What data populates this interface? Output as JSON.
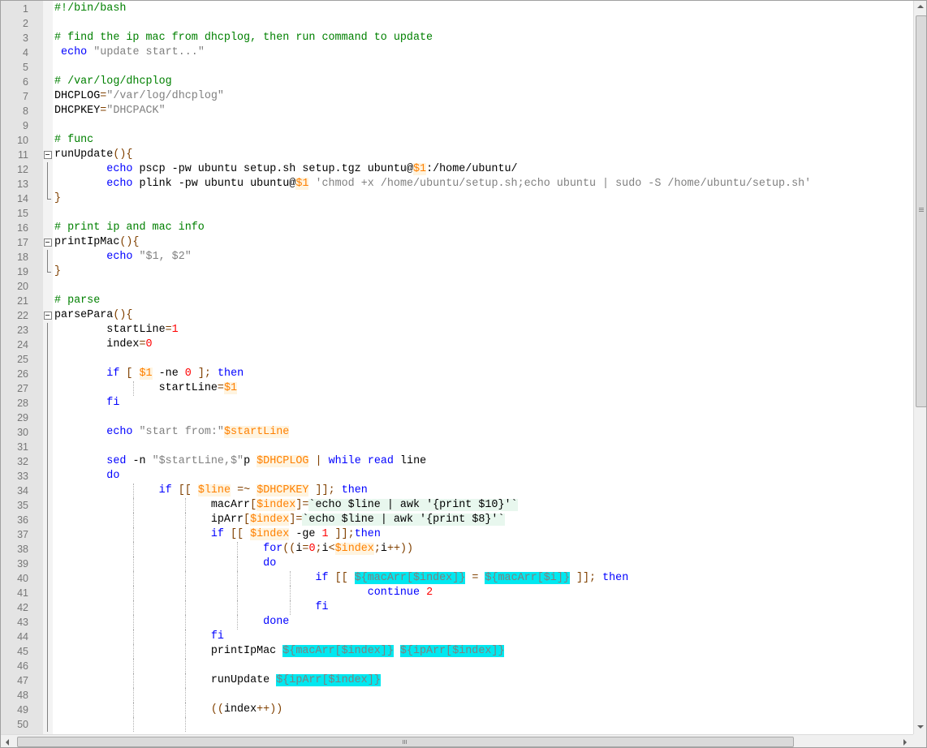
{
  "editor": {
    "language": "bash",
    "line_count_visible": 50
  },
  "colors": {
    "comment": "#008000",
    "keyword": "#0000ff",
    "string": "#808080",
    "number": "#ff0000",
    "variable": "#ff8000",
    "operator": "#804000",
    "expansion_highlight": "#00e8f0",
    "backtick_highlight": "#e8f7ee"
  },
  "lines": [
    {
      "n": "1",
      "guides": [],
      "fold": null,
      "tokens": [
        {
          "t": "c",
          "v": "#!/bin/bash"
        }
      ]
    },
    {
      "n": "2",
      "guides": [],
      "fold": null,
      "tokens": []
    },
    {
      "n": "3",
      "guides": [],
      "fold": null,
      "tokens": [
        {
          "t": "c",
          "v": "# find the ip mac from dhcplog, then run command to update"
        }
      ]
    },
    {
      "n": "4",
      "guides": [],
      "fold": null,
      "tokens": [
        {
          "t": "p",
          "v": " "
        },
        {
          "t": "k",
          "v": "echo"
        },
        {
          "t": "p",
          "v": " "
        },
        {
          "t": "s",
          "v": "\"update start...\""
        }
      ]
    },
    {
      "n": "5",
      "guides": [],
      "fold": null,
      "tokens": []
    },
    {
      "n": "6",
      "guides": [],
      "fold": null,
      "tokens": [
        {
          "t": "c",
          "v": "# /var/log/dhcplog"
        }
      ]
    },
    {
      "n": "7",
      "guides": [],
      "fold": null,
      "tokens": [
        {
          "t": "p",
          "v": "DHCPLOG"
        },
        {
          "t": "o",
          "v": "="
        },
        {
          "t": "s",
          "v": "\"/var/log/dhcplog\""
        }
      ]
    },
    {
      "n": "8",
      "guides": [],
      "fold": null,
      "tokens": [
        {
          "t": "p",
          "v": "DHCPKEY"
        },
        {
          "t": "o",
          "v": "="
        },
        {
          "t": "s",
          "v": "\"DHCPACK\""
        }
      ]
    },
    {
      "n": "9",
      "guides": [],
      "fold": null,
      "tokens": []
    },
    {
      "n": "10",
      "guides": [],
      "fold": null,
      "tokens": [
        {
          "t": "c",
          "v": "# func"
        }
      ]
    },
    {
      "n": "11",
      "guides": [],
      "fold": "box",
      "tokens": [
        {
          "t": "p",
          "v": "runUpdate"
        },
        {
          "t": "o",
          "v": "(){"
        }
      ]
    },
    {
      "n": "12",
      "guides": [],
      "fold": "vl",
      "tokens": [
        {
          "t": "p",
          "v": "        "
        },
        {
          "t": "k",
          "v": "echo"
        },
        {
          "t": "p",
          "v": " pscp -pw ubuntu setup.sh setup.tgz ubuntu@"
        },
        {
          "t": "v",
          "v": "$1"
        },
        {
          "t": "p",
          "v": ":/home/ubuntu/"
        }
      ]
    },
    {
      "n": "13",
      "guides": [],
      "fold": "vl",
      "tokens": [
        {
          "t": "p",
          "v": "        "
        },
        {
          "t": "k",
          "v": "echo"
        },
        {
          "t": "p",
          "v": " plink -pw ubuntu ubuntu@"
        },
        {
          "t": "v",
          "v": "$1"
        },
        {
          "t": "p",
          "v": " "
        },
        {
          "t": "s",
          "v": "'chmod +x /home/ubuntu/setup.sh;echo ubuntu | sudo -S /home/ubuntu/setup.sh'"
        }
      ]
    },
    {
      "n": "14",
      "guides": [],
      "fold": "end",
      "tokens": [
        {
          "t": "o",
          "v": "}"
        }
      ]
    },
    {
      "n": "15",
      "guides": [],
      "fold": null,
      "tokens": []
    },
    {
      "n": "16",
      "guides": [],
      "fold": null,
      "tokens": [
        {
          "t": "c",
          "v": "# print ip and mac info"
        }
      ]
    },
    {
      "n": "17",
      "guides": [],
      "fold": "box",
      "tokens": [
        {
          "t": "p",
          "v": "printIpMac"
        },
        {
          "t": "o",
          "v": "(){"
        }
      ]
    },
    {
      "n": "18",
      "guides": [],
      "fold": "vl",
      "tokens": [
        {
          "t": "p",
          "v": "        "
        },
        {
          "t": "k",
          "v": "echo"
        },
        {
          "t": "p",
          "v": " "
        },
        {
          "t": "s",
          "v": "\"$1, $2\""
        }
      ]
    },
    {
      "n": "19",
      "guides": [],
      "fold": "end",
      "tokens": [
        {
          "t": "o",
          "v": "}"
        }
      ]
    },
    {
      "n": "20",
      "guides": [],
      "fold": null,
      "tokens": []
    },
    {
      "n": "21",
      "guides": [],
      "fold": null,
      "tokens": [
        {
          "t": "c",
          "v": "# parse"
        }
      ]
    },
    {
      "n": "22",
      "guides": [],
      "fold": "box",
      "tokens": [
        {
          "t": "p",
          "v": "parsePara"
        },
        {
          "t": "o",
          "v": "(){"
        }
      ]
    },
    {
      "n": "23",
      "guides": [],
      "fold": "vl",
      "tokens": [
        {
          "t": "p",
          "v": "        startLine"
        },
        {
          "t": "o",
          "v": "="
        },
        {
          "t": "n",
          "v": "1"
        }
      ]
    },
    {
      "n": "24",
      "guides": [],
      "fold": "vl",
      "tokens": [
        {
          "t": "p",
          "v": "        index"
        },
        {
          "t": "o",
          "v": "="
        },
        {
          "t": "n",
          "v": "0"
        }
      ]
    },
    {
      "n": "25",
      "guides": [],
      "fold": "vl",
      "tokens": []
    },
    {
      "n": "26",
      "guides": [],
      "fold": "vl",
      "tokens": [
        {
          "t": "p",
          "v": "        "
        },
        {
          "t": "k",
          "v": "if"
        },
        {
          "t": "p",
          "v": " "
        },
        {
          "t": "o",
          "v": "["
        },
        {
          "t": "p",
          "v": " "
        },
        {
          "t": "v",
          "v": "$1"
        },
        {
          "t": "p",
          "v": " -ne "
        },
        {
          "t": "n",
          "v": "0"
        },
        {
          "t": "p",
          "v": " "
        },
        {
          "t": "o",
          "v": "];"
        },
        {
          "t": "p",
          "v": " "
        },
        {
          "t": "k",
          "v": "then"
        }
      ]
    },
    {
      "n": "27",
      "guides": [
        12
      ],
      "fold": "vl",
      "tokens": [
        {
          "t": "p",
          "v": "                startLine"
        },
        {
          "t": "o",
          "v": "="
        },
        {
          "t": "v",
          "v": "$1"
        }
      ]
    },
    {
      "n": "28",
      "guides": [],
      "fold": "vl",
      "tokens": [
        {
          "t": "p",
          "v": "        "
        },
        {
          "t": "k",
          "v": "fi"
        }
      ]
    },
    {
      "n": "29",
      "guides": [],
      "fold": "vl",
      "tokens": []
    },
    {
      "n": "30",
      "guides": [],
      "fold": "vl",
      "tokens": [
        {
          "t": "p",
          "v": "        "
        },
        {
          "t": "k",
          "v": "echo"
        },
        {
          "t": "p",
          "v": " "
        },
        {
          "t": "s",
          "v": "\"start from:\""
        },
        {
          "t": "v",
          "v": "$startLine"
        }
      ]
    },
    {
      "n": "31",
      "guides": [],
      "fold": "vl",
      "tokens": []
    },
    {
      "n": "32",
      "guides": [],
      "fold": "vl",
      "tokens": [
        {
          "t": "p",
          "v": "        "
        },
        {
          "t": "k",
          "v": "sed"
        },
        {
          "t": "p",
          "v": " -n "
        },
        {
          "t": "s",
          "v": "\"$startLine,$\""
        },
        {
          "t": "p",
          "v": "p "
        },
        {
          "t": "v",
          "v": "$DHCPLOG"
        },
        {
          "t": "p",
          "v": " "
        },
        {
          "t": "o",
          "v": "|"
        },
        {
          "t": "p",
          "v": " "
        },
        {
          "t": "k",
          "v": "while"
        },
        {
          "t": "p",
          "v": " "
        },
        {
          "t": "k",
          "v": "read"
        },
        {
          "t": "p",
          "v": " line"
        }
      ]
    },
    {
      "n": "33",
      "guides": [],
      "fold": "vl",
      "tokens": [
        {
          "t": "p",
          "v": "        "
        },
        {
          "t": "k",
          "v": "do"
        }
      ]
    },
    {
      "n": "34",
      "guides": [
        12
      ],
      "fold": "vl",
      "tokens": [
        {
          "t": "p",
          "v": "                "
        },
        {
          "t": "k",
          "v": "if"
        },
        {
          "t": "p",
          "v": " "
        },
        {
          "t": "o",
          "v": "[["
        },
        {
          "t": "p",
          "v": " "
        },
        {
          "t": "v",
          "v": "$line"
        },
        {
          "t": "p",
          "v": " "
        },
        {
          "t": "o",
          "v": "=~"
        },
        {
          "t": "p",
          "v": " "
        },
        {
          "t": "v",
          "v": "$DHCPKEY"
        },
        {
          "t": "p",
          "v": " "
        },
        {
          "t": "o",
          "v": "]];"
        },
        {
          "t": "p",
          "v": " "
        },
        {
          "t": "k",
          "v": "then"
        }
      ]
    },
    {
      "n": "35",
      "guides": [
        12,
        20
      ],
      "fold": "vl",
      "tokens": [
        {
          "t": "p",
          "v": "                        macArr"
        },
        {
          "t": "o",
          "v": "["
        },
        {
          "t": "v",
          "v": "$index"
        },
        {
          "t": "o",
          "v": "]="
        },
        {
          "t": "b",
          "v": "`echo $line | awk '{print $10}'`"
        }
      ]
    },
    {
      "n": "36",
      "guides": [
        12,
        20
      ],
      "fold": "vl",
      "tokens": [
        {
          "t": "p",
          "v": "                        ipArr"
        },
        {
          "t": "o",
          "v": "["
        },
        {
          "t": "v",
          "v": "$index"
        },
        {
          "t": "o",
          "v": "]="
        },
        {
          "t": "b",
          "v": "`echo $line | awk '{print $8}'`"
        }
      ]
    },
    {
      "n": "37",
      "guides": [
        12,
        20
      ],
      "fold": "vl",
      "tokens": [
        {
          "t": "p",
          "v": "                        "
        },
        {
          "t": "k",
          "v": "if"
        },
        {
          "t": "p",
          "v": " "
        },
        {
          "t": "o",
          "v": "[["
        },
        {
          "t": "p",
          "v": " "
        },
        {
          "t": "v",
          "v": "$index"
        },
        {
          "t": "p",
          "v": " -ge "
        },
        {
          "t": "n",
          "v": "1"
        },
        {
          "t": "p",
          "v": " "
        },
        {
          "t": "o",
          "v": "]];"
        },
        {
          "t": "k",
          "v": "then"
        }
      ]
    },
    {
      "n": "38",
      "guides": [
        12,
        20,
        28
      ],
      "fold": "vl",
      "tokens": [
        {
          "t": "p",
          "v": "                                "
        },
        {
          "t": "k",
          "v": "for"
        },
        {
          "t": "o",
          "v": "(("
        },
        {
          "t": "p",
          "v": "i"
        },
        {
          "t": "o",
          "v": "="
        },
        {
          "t": "n",
          "v": "0"
        },
        {
          "t": "o",
          "v": ";"
        },
        {
          "t": "p",
          "v": "i"
        },
        {
          "t": "o",
          "v": "<"
        },
        {
          "t": "v",
          "v": "$index"
        },
        {
          "t": "o",
          "v": ";"
        },
        {
          "t": "p",
          "v": "i"
        },
        {
          "t": "o",
          "v": "++))"
        }
      ]
    },
    {
      "n": "39",
      "guides": [
        12,
        20,
        28
      ],
      "fold": "vl",
      "tokens": [
        {
          "t": "p",
          "v": "                                "
        },
        {
          "t": "k",
          "v": "do"
        }
      ]
    },
    {
      "n": "40",
      "guides": [
        12,
        20,
        28,
        36
      ],
      "fold": "vl",
      "tokens": [
        {
          "t": "p",
          "v": "                                        "
        },
        {
          "t": "k",
          "v": "if"
        },
        {
          "t": "p",
          "v": " "
        },
        {
          "t": "o",
          "v": "[["
        },
        {
          "t": "p",
          "v": " "
        },
        {
          "t": "x",
          "v": "${macArr[$index]}"
        },
        {
          "t": "p",
          "v": " "
        },
        {
          "t": "o",
          "v": "="
        },
        {
          "t": "p",
          "v": " "
        },
        {
          "t": "x",
          "v": "${macArr[$i]}"
        },
        {
          "t": "p",
          "v": " "
        },
        {
          "t": "o",
          "v": "]];"
        },
        {
          "t": "p",
          "v": " "
        },
        {
          "t": "k",
          "v": "then"
        }
      ]
    },
    {
      "n": "41",
      "guides": [
        12,
        20,
        28,
        36
      ],
      "fold": "vl",
      "tokens": [
        {
          "t": "p",
          "v": "                                                "
        },
        {
          "t": "k",
          "v": "continue"
        },
        {
          "t": "p",
          "v": " "
        },
        {
          "t": "n",
          "v": "2"
        }
      ]
    },
    {
      "n": "42",
      "guides": [
        12,
        20,
        28,
        36
      ],
      "fold": "vl",
      "tokens": [
        {
          "t": "p",
          "v": "                                        "
        },
        {
          "t": "k",
          "v": "fi"
        }
      ]
    },
    {
      "n": "43",
      "guides": [
        12,
        20,
        28
      ],
      "fold": "vl",
      "tokens": [
        {
          "t": "p",
          "v": "                                "
        },
        {
          "t": "k",
          "v": "done"
        }
      ]
    },
    {
      "n": "44",
      "guides": [
        12,
        20
      ],
      "fold": "vl",
      "tokens": [
        {
          "t": "p",
          "v": "                        "
        },
        {
          "t": "k",
          "v": "fi"
        }
      ]
    },
    {
      "n": "45",
      "guides": [
        12,
        20
      ],
      "fold": "vl",
      "tokens": [
        {
          "t": "p",
          "v": "                        printIpMac "
        },
        {
          "t": "x",
          "v": "${macArr[$index]}"
        },
        {
          "t": "p",
          "v": " "
        },
        {
          "t": "x",
          "v": "${ipArr[$index]}"
        }
      ]
    },
    {
      "n": "46",
      "guides": [
        12,
        20
      ],
      "fold": "vl",
      "tokens": []
    },
    {
      "n": "47",
      "guides": [
        12,
        20
      ],
      "fold": "vl",
      "tokens": [
        {
          "t": "p",
          "v": "                        runUpdate "
        },
        {
          "t": "x",
          "v": "${ipArr[$index]}"
        }
      ]
    },
    {
      "n": "48",
      "guides": [
        12,
        20
      ],
      "fold": "vl",
      "tokens": []
    },
    {
      "n": "49",
      "guides": [
        12,
        20
      ],
      "fold": "vl",
      "tokens": [
        {
          "t": "p",
          "v": "                        "
        },
        {
          "t": "o",
          "v": "(("
        },
        {
          "t": "p",
          "v": "index"
        },
        {
          "t": "o",
          "v": "++))"
        }
      ]
    },
    {
      "n": "50",
      "guides": [
        12,
        20
      ],
      "fold": "vl",
      "tokens": []
    }
  ]
}
